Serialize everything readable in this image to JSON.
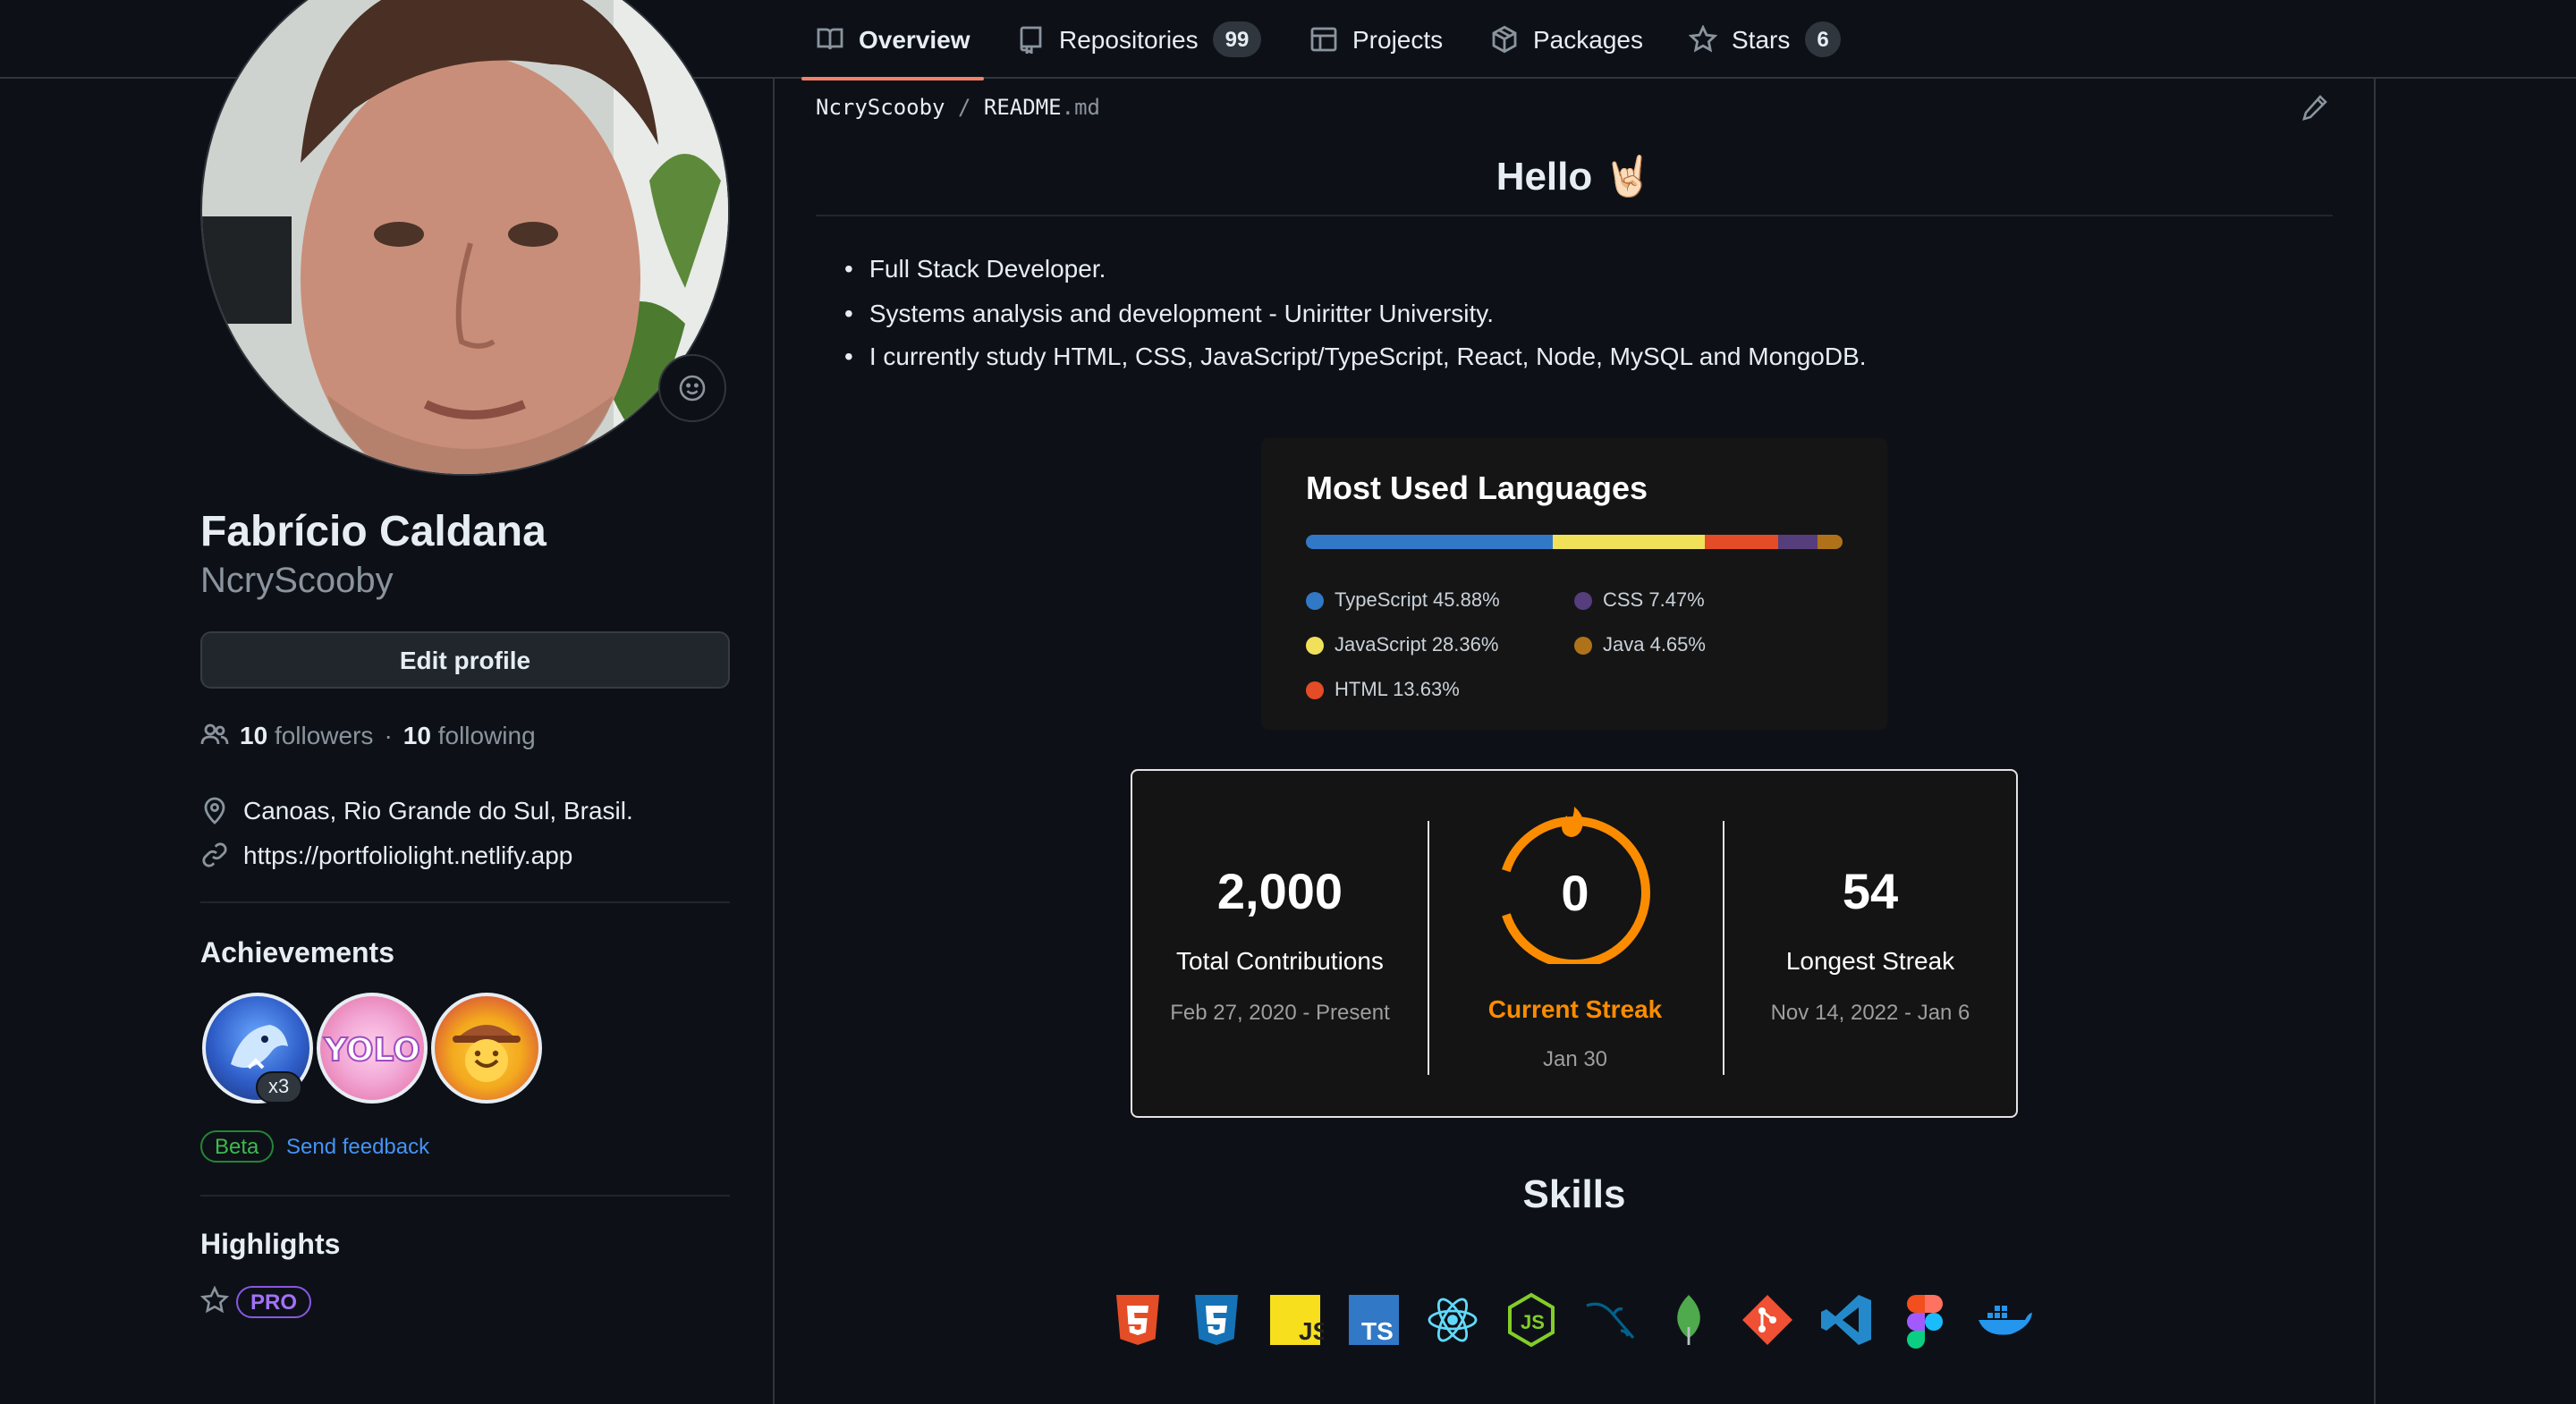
{
  "nav": {
    "tabs": [
      {
        "label": "Overview",
        "icon": "book-icon",
        "active": true
      },
      {
        "label": "Repositories",
        "icon": "repo-icon",
        "count": "99"
      },
      {
        "label": "Projects",
        "icon": "table-icon"
      },
      {
        "label": "Packages",
        "icon": "package-icon"
      },
      {
        "label": "Stars",
        "icon": "star-icon",
        "count": "6"
      }
    ]
  },
  "profile": {
    "name": "Fabrício Caldana",
    "username": "NcryScooby",
    "edit_label": "Edit profile",
    "followers_count": "10",
    "followers_label": "followers",
    "separator": "·",
    "following_count": "10",
    "following_label": "following",
    "location": "Canoas, Rio Grande do Sul, Brasil.",
    "website": "https://portfoliolight.netlify.app"
  },
  "achievements": {
    "title": "Achievements",
    "badges": [
      {
        "icon": "shark-achievement-icon",
        "count": "x3"
      },
      {
        "icon": "yolo-achievement-icon"
      },
      {
        "icon": "quickdraw-achievement-icon"
      }
    ],
    "beta_label": "Beta",
    "feedback_label": "Send feedback"
  },
  "highlights": {
    "title": "Highlights",
    "pro_label": "PRO"
  },
  "readme": {
    "path_user": "NcryScooby",
    "path_sep": "/",
    "path_file": "README",
    "path_ext": ".md",
    "heading": "Hello 🤘🏻",
    "bio": [
      "Full Stack Developer.",
      "Systems analysis and development - Uniritter University.",
      "I currently study HTML, CSS, JavaScript/TypeScript, React, Node, MySQL and MongoDB."
    ]
  },
  "languages_card": {
    "title": "Most Used Languages",
    "languages": [
      {
        "name": "TypeScript",
        "percent": 45.88,
        "label": "TypeScript 45.88%",
        "color": "#3178c6"
      },
      {
        "name": "JavaScript",
        "percent": 28.36,
        "label": "JavaScript 28.36%",
        "color": "#f1e05a"
      },
      {
        "name": "HTML",
        "percent": 13.63,
        "label": "HTML 13.63%",
        "color": "#e34c26"
      },
      {
        "name": "CSS",
        "percent": 7.47,
        "label": "CSS 7.47%",
        "color": "#563d7c"
      },
      {
        "name": "Java",
        "percent": 4.65,
        "label": "Java 4.65%",
        "color": "#b07219"
      }
    ]
  },
  "streak_card": {
    "total": "2,000",
    "total_label": "Total Contributions",
    "total_range": "Feb 27, 2020 - Present",
    "current": "0",
    "current_label": "Current Streak",
    "current_range": "Jan 30",
    "longest": "54",
    "longest_label": "Longest Streak",
    "longest_range": "Nov 14, 2022 - Jan 6",
    "accent": "#fb8c00"
  },
  "skills": {
    "title": "Skills",
    "icons": [
      "html5-icon",
      "css3-icon",
      "javascript-icon",
      "typescript-icon",
      "react-icon",
      "nodejs-icon",
      "mysql-icon",
      "mongodb-icon",
      "git-icon",
      "vscode-icon",
      "figma-icon",
      "docker-icon"
    ]
  }
}
